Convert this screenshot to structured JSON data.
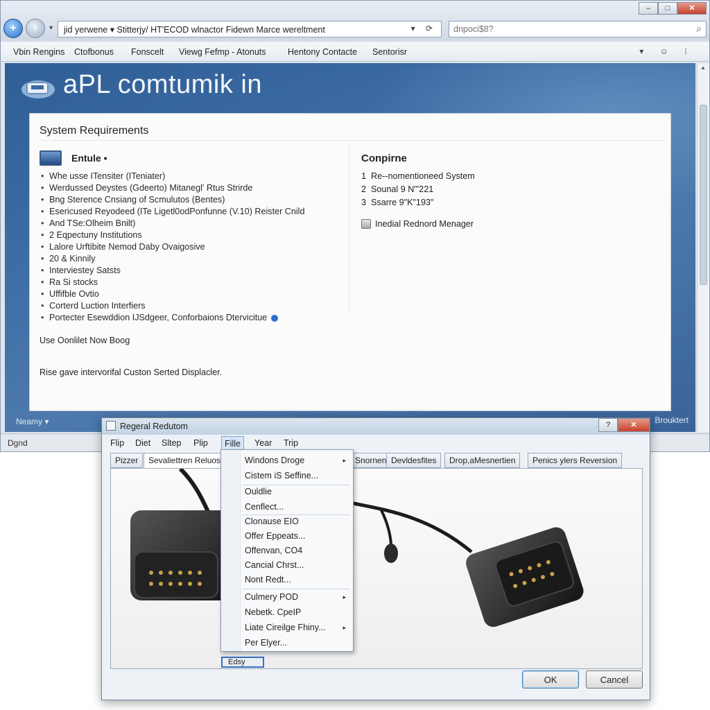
{
  "browser": {
    "address": "jid yerwene ▾ Stitterjy/ HT'ECOD wlnactor Fidewn Marce wereltment",
    "search_placeholder": "dnpoci$8?",
    "menu": [
      "Vbin Rengins",
      "Ctofbonus",
      "Fonscelt",
      "Viewg Fefmp - Atonuts",
      "Hentony Contacte",
      "Sentorisr"
    ],
    "logo_text": "aPL comtumik in",
    "status_left": "Neamy ▾",
    "status_right": "Brouktert",
    "bottom_left": "Dgnd"
  },
  "panel": {
    "title": "System Requirements",
    "left_heading": "Entule •",
    "requirements": [
      "Whe usse ITensiter (ITeniater)",
      "Werdussed Deystes (Gdeerto) Mitanegl' Rtus Strirde",
      "Bng Sterence Cnsiang of Scmulutos (Bentes)",
      "Esericused Reyodeed (ITe Ligetl0odPonfunne (V.10) Reister Cnild",
      "And TSe:Olheim Bnilt)",
      "2 Eqpectuny Institutions",
      "Lalore Urftibite Nemod Daby Ovaigosive",
      "20 & Kinnily",
      "Interviestey Satsts",
      "Ra Si stocks",
      "Uffifble Ovtio",
      "Corterd Luction Interfiers",
      "Portecter Esewddion IJSdgeer, Conforbaions Dtervicitue"
    ],
    "note1": "Use Oonlilet Now Boog",
    "note2": "Rise gave intervorifal Custon Serted Displacler.",
    "right_heading": "Conpirne",
    "right_items": [
      {
        "num": "1",
        "text": "Re--nomentioneed System"
      },
      {
        "num": "2",
        "text": "Sounal 9 N\"'221"
      },
      {
        "num": "3",
        "text": "Ssarre 9\"K\"193\""
      }
    ],
    "device_manager": "Inedial Rednord Menager"
  },
  "dialog": {
    "title": "Regeral Redutom",
    "menu": [
      "Flip",
      "Diet",
      "Sltep",
      "Plip",
      "Fille",
      "Year",
      "Trip"
    ],
    "active_menu": "Fille",
    "tabs": [
      "Pizzer",
      "Sevaliettren Reluos",
      "Snornente",
      "Devldesfites",
      "Drop,aMesnertien",
      "Penics ylers Reversion"
    ],
    "dropdown": [
      "Windons Droge",
      "Cistem iS Seffine...",
      "Ouldlie",
      "Cenflect...",
      "Clonause EIO",
      "Offer Eppeats...",
      "Offenvan, CO4",
      "Cancial Chrst...",
      "Nont Redt...",
      "Culmery POD",
      "Nebetk. CpeIP",
      "Liate Cireilge Fhiny...",
      "Per Elyer..."
    ],
    "small_box": "Edsy",
    "ok": "OK",
    "cancel": "Cancel"
  },
  "colors": {
    "page_blue": "#3f6ea5",
    "accent": "#2f6fcb",
    "close_red": "#c8412b"
  }
}
